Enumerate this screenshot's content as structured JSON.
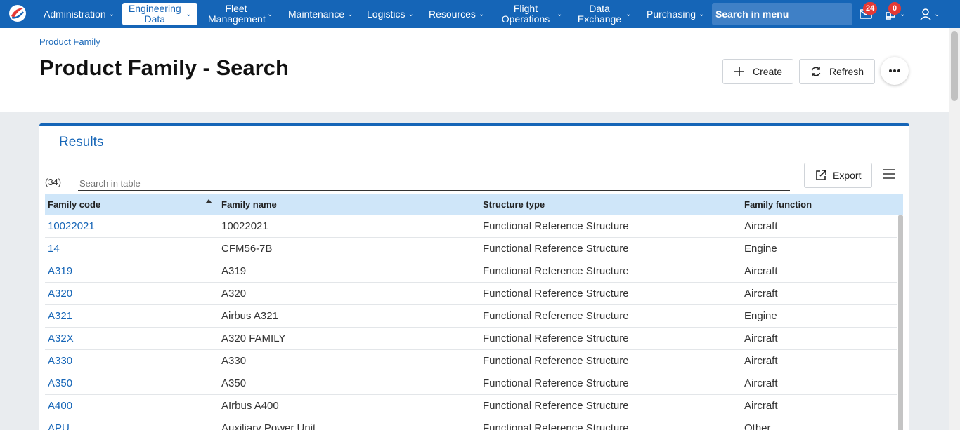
{
  "nav": {
    "items": [
      {
        "label": "Administration"
      },
      {
        "label": "Engineering Data"
      },
      {
        "label": "Fleet Management"
      },
      {
        "label": "Maintenance"
      },
      {
        "label": "Logistics"
      },
      {
        "label": "Resources"
      },
      {
        "label": "Flight Operations"
      },
      {
        "label": "Data Exchange"
      },
      {
        "label": "Purchasing"
      }
    ],
    "search_label": "Search in menu",
    "mail_count": "24",
    "bench_count": "0",
    "colors": {
      "brand": "#1565b7",
      "badge": "#e53935",
      "header_row": "#cfe6f9"
    }
  },
  "header": {
    "breadcrumb": "Product Family",
    "title": "Product Family - Search",
    "create_label": "Create",
    "refresh_label": "Refresh"
  },
  "results": {
    "title": "Results",
    "count": "(34)",
    "search_placeholder": "Search in table",
    "export_label": "Export",
    "columns": [
      "Family code",
      "Family name",
      "Structure type",
      "Family function"
    ],
    "rows": [
      {
        "code": "10022021",
        "name": "10022021",
        "structure": "Functional Reference Structure",
        "function": "Aircraft"
      },
      {
        "code": "14",
        "name": "CFM56-7B",
        "structure": "Functional Reference Structure",
        "function": "Engine"
      },
      {
        "code": "A319",
        "name": "A319",
        "structure": "Functional Reference Structure",
        "function": "Aircraft"
      },
      {
        "code": "A320",
        "name": "A320",
        "structure": "Functional Reference Structure",
        "function": "Aircraft"
      },
      {
        "code": "A321",
        "name": "Airbus A321",
        "structure": "Functional Reference Structure",
        "function": "Engine"
      },
      {
        "code": "A32X",
        "name": "A320 FAMILY",
        "structure": "Functional Reference Structure",
        "function": "Aircraft"
      },
      {
        "code": "A330",
        "name": "A330",
        "structure": "Functional Reference Structure",
        "function": "Aircraft"
      },
      {
        "code": "A350",
        "name": "A350",
        "structure": "Functional Reference Structure",
        "function": "Aircraft"
      },
      {
        "code": "A400",
        "name": "AIrbus A400",
        "structure": "Functional Reference Structure",
        "function": "Aircraft"
      },
      {
        "code": "APU",
        "name": "Auxiliary Power Unit",
        "structure": "Functional Reference Structure",
        "function": "Other"
      }
    ]
  }
}
